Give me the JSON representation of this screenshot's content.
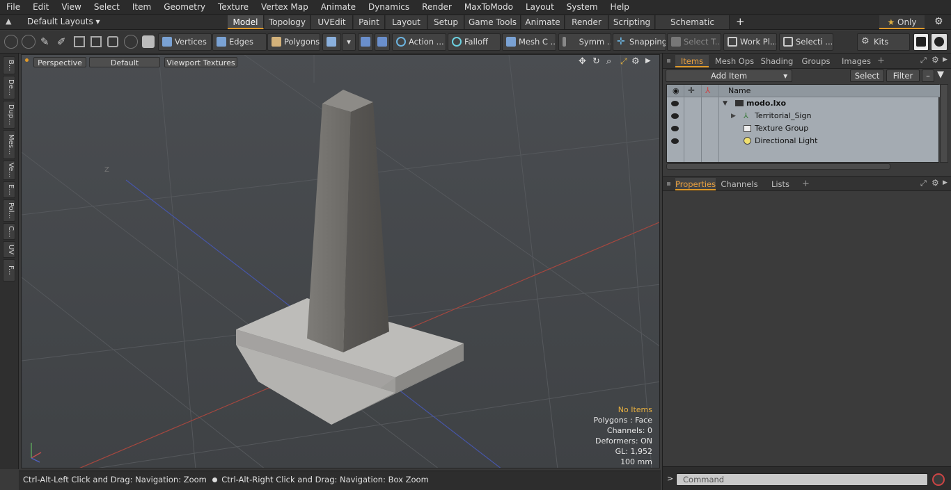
{
  "menu": [
    "File",
    "Edit",
    "View",
    "Select",
    "Item",
    "Geometry",
    "Texture",
    "Vertex Map",
    "Animate",
    "Dynamics",
    "Render",
    "MaxToModo",
    "Layout",
    "System",
    "Help"
  ],
  "layout_selector": "Default Layouts",
  "tabs": [
    "Model",
    "Topology",
    "UVEdit",
    "Paint",
    "Layout",
    "Setup",
    "Game Tools",
    "Animate",
    "Render",
    "Scripting",
    "Schematic Fusion"
  ],
  "tab_add": "+",
  "only_label": "Only",
  "toolbar": {
    "vertices": "Vertices",
    "edges": "Edges",
    "polygons": "Polygons",
    "action": "Action ...",
    "falloff": "Falloff",
    "mesh_c": "Mesh C ...",
    "symm": "Symm ...",
    "snapping": "Snapping",
    "select_t": "Select T...",
    "work_pl": "Work Pl...",
    "selecti": "Selecti ...",
    "kits": "Kits"
  },
  "left_tabs": [
    "B...",
    "De...",
    "Dup...",
    "Mes...",
    "Ve...",
    "E...",
    "Pol...",
    "C...",
    "UV",
    "F..."
  ],
  "viewport": {
    "perspective": "Perspective",
    "default": "Default",
    "textures": "Viewport Textures",
    "axis_label": "Z",
    "info": {
      "no_items": "No Items",
      "polygons": "Polygons : Face",
      "channels": "Channels: 0",
      "deformers": "Deformers: ON",
      "gl": "GL: 1,952",
      "unit": "100 mm"
    }
  },
  "status": {
    "left": "Ctrl-Alt-Left Click and Drag: Navigation: Zoom",
    "right": "Ctrl-Alt-Right Click and Drag: Navigation: Box Zoom"
  },
  "items_panel": {
    "tabs": [
      "Items",
      "Mesh Ops",
      "Shading",
      "Groups",
      "Images"
    ],
    "add_item": "Add Item",
    "select": "Select",
    "filter": "Filter",
    "col_name": "Name",
    "rows": [
      "modo.lxo",
      "Territorial_Sign",
      "Texture Group",
      "Directional Light"
    ]
  },
  "props_panel": {
    "tabs": [
      "Properties",
      "Channels",
      "Lists"
    ]
  },
  "command": {
    "prompt": ">",
    "placeholder": "Command"
  },
  "colors": {
    "accent": "#e09a2a",
    "x_axis": "#c0504d",
    "z_axis": "#4a5fc0"
  }
}
